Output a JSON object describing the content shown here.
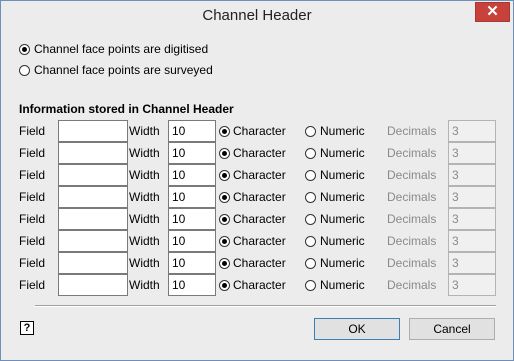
{
  "window": {
    "title": "Channel Header",
    "close_glyph": "✕"
  },
  "mode_options": [
    {
      "label": "Channel face points are digitised",
      "selected": true
    },
    {
      "label": "Channel face points are surveyed",
      "selected": false
    }
  ],
  "group": {
    "title": "Information stored in Channel Header"
  },
  "row_labels": {
    "field": "Field",
    "width": "Width",
    "character": "Character",
    "numeric": "Numeric",
    "decimals": "Decimals"
  },
  "rows": [
    {
      "field": "",
      "width": "10",
      "type": "Character",
      "decimals": "3"
    },
    {
      "field": "",
      "width": "10",
      "type": "Character",
      "decimals": "3"
    },
    {
      "field": "",
      "width": "10",
      "type": "Character",
      "decimals": "3"
    },
    {
      "field": "",
      "width": "10",
      "type": "Character",
      "decimals": "3"
    },
    {
      "field": "",
      "width": "10",
      "type": "Character",
      "decimals": "3"
    },
    {
      "field": "",
      "width": "10",
      "type": "Character",
      "decimals": "3"
    },
    {
      "field": "",
      "width": "10",
      "type": "Character",
      "decimals": "3"
    },
    {
      "field": "",
      "width": "10",
      "type": "Character",
      "decimals": "3"
    }
  ],
  "buttons": {
    "ok": "OK",
    "cancel": "Cancel"
  },
  "help": {
    "glyph": "?"
  },
  "icons": {
    "close": "close-icon",
    "help": "help-icon"
  }
}
